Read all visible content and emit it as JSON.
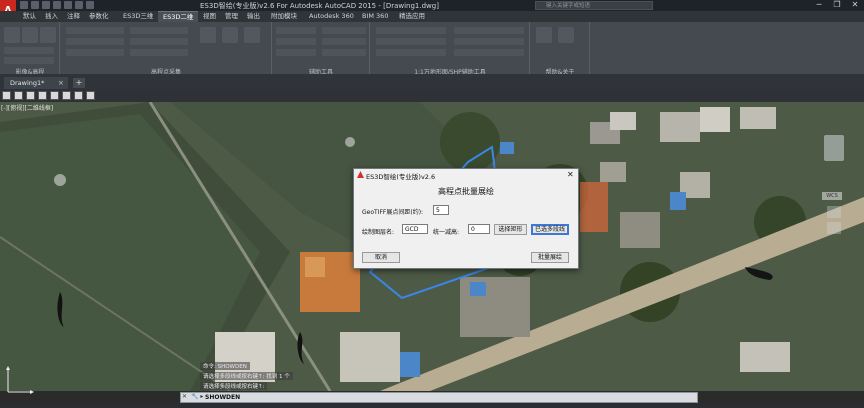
{
  "titlebar": {
    "app_letter": "A",
    "title": "ES3D智绘(专业版)v2.6 For Autodesk AutoCAD 2015 - [Drawing1.dwg]",
    "file": "Drawing1.dwg",
    "search_placeholder": "键入关键字或短语",
    "minimize": "─",
    "restore": "❐",
    "close": "✕"
  },
  "ribbon_tabs": [
    "默认",
    "插入",
    "注释",
    "参数化",
    "ES3D三维",
    "ES3D二维",
    "视图",
    "管理",
    "输出",
    "附加模块",
    "Autodesk 360",
    "BIM 360",
    "精选应用"
  ],
  "active_tab_index": 5,
  "ribbon_groups": [
    "影像&高程",
    "高程点采集",
    "辅助工具",
    "1:1万地形图/SHP辅助工具",
    "帮助&关于"
  ],
  "document_tab": {
    "name": "Drawing1*",
    "close": "×",
    "new_tab": "+"
  },
  "view_label": "[-][俯视][二维线框]",
  "navigation": {
    "wcs": "WCS"
  },
  "command": {
    "history": [
      "命令: SHOWDEN",
      "请选择多段线或按右键↑: 找到 1 个",
      "请选择多段线或按右键↑:"
    ],
    "close": "✕",
    "prefix": "🔧 ▸",
    "current": "SHOWDEN"
  },
  "dialog": {
    "title": "ES3D智绘(专业版)v2.6",
    "close": "✕",
    "heading": "高程点批量展绘",
    "interval_label": "GeoTIFF展点间距(约):",
    "interval_value": "5",
    "layer_label": "绘制图层名:",
    "layer_value": "GCD",
    "elev_label": "统一减高:",
    "elev_value": "0",
    "btn_rect": "选择矩形",
    "btn_poly": "已选多段线",
    "btn_cancel": "取消",
    "btn_batch": "批量展绘"
  }
}
